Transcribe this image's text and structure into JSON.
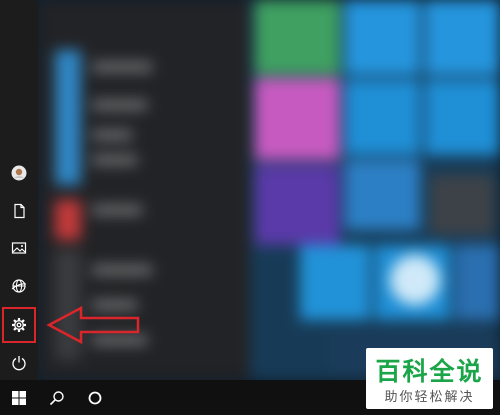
{
  "colors": {
    "rail_bg": "#1c1c1c",
    "taskbar_bg": "#101010",
    "highlight": "#d9262a",
    "arrow": "#d9262a",
    "tile_blue": "#1f8fd6",
    "watermark_green": "#1aa548"
  },
  "rail": {
    "items": [
      {
        "name": "user-account",
        "icon": "avatar-icon"
      },
      {
        "name": "documents",
        "icon": "document-icon"
      },
      {
        "name": "pictures",
        "icon": "pictures-icon"
      },
      {
        "name": "network",
        "icon": "globe-icon"
      },
      {
        "name": "settings",
        "icon": "gear-icon",
        "highlighted": true
      },
      {
        "name": "power",
        "icon": "power-icon"
      }
    ]
  },
  "taskbar": {
    "items": [
      {
        "name": "start",
        "icon": "windows-logo-icon"
      },
      {
        "name": "search",
        "icon": "search-icon"
      },
      {
        "name": "cortana",
        "icon": "circle-icon"
      }
    ]
  },
  "annotation": {
    "arrow_direction": "left",
    "target": "settings"
  },
  "watermark": {
    "main": "百科全说",
    "sub": "助你轻松解决"
  }
}
